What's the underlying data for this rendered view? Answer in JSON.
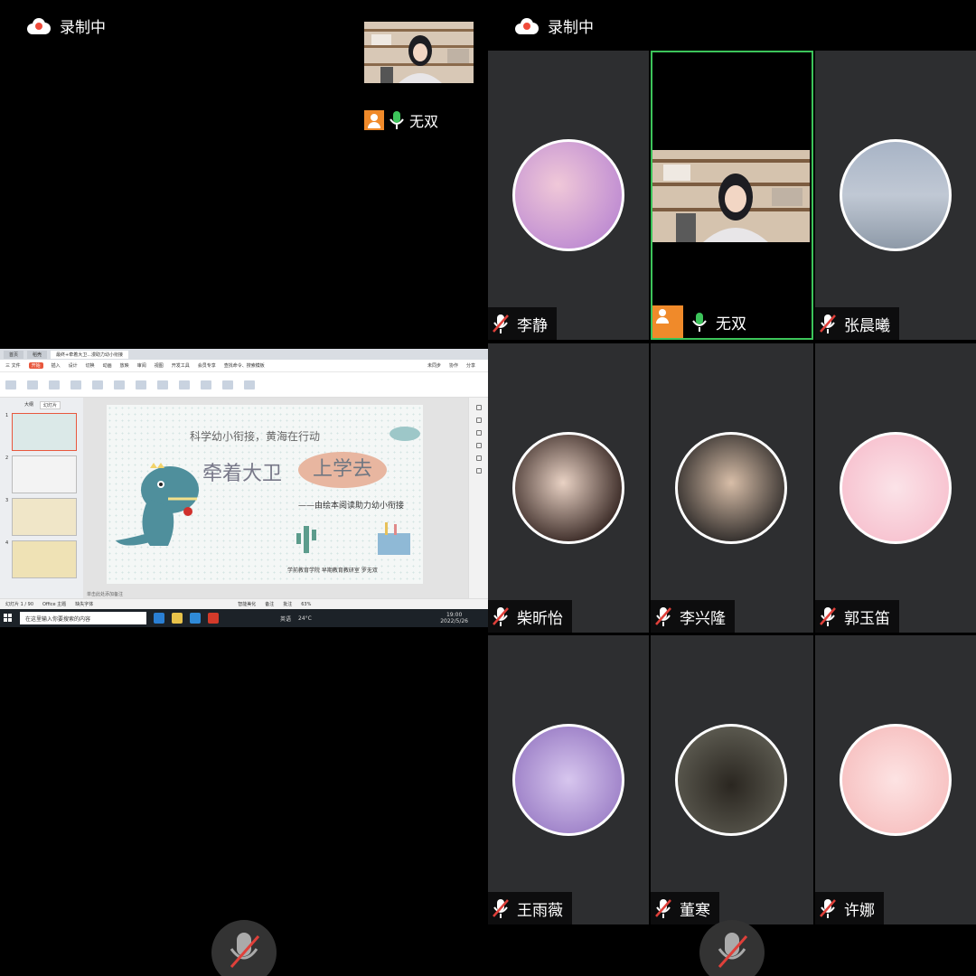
{
  "recording_label": "录制中",
  "self_view": {
    "name": "无双"
  },
  "shared_screen": {
    "browser_tabs": [
      "首页",
      "稻壳",
      "最终+牵着大卫...漫助力幼小衔接"
    ],
    "menu": [
      "三 文件",
      "开始",
      "插入",
      "设计",
      "切换",
      "动画",
      "放映",
      "审阅",
      "视图",
      "开发工具",
      "会员专享",
      "查找命令、搜索模板",
      "未同步",
      "协作",
      "分享"
    ],
    "panel_tabs": [
      "大纲",
      "幻灯片"
    ],
    "slide_numbers": [
      "1",
      "2",
      "3",
      "4"
    ],
    "slide": {
      "top_line": "科学幼小衔接，黄海在行动",
      "title_a": "牵着大卫",
      "title_b": "上学去",
      "subtitle": "——由绘本阅读助力幼小衔接",
      "credit": "学前教育学院    早期教育教研室  罗无双"
    },
    "notes_placeholder": "单击此处添加备注",
    "status": {
      "slide_count": "幻灯片 1 / 90",
      "theme": "Office 主题",
      "font_missing": "缺失字体",
      "smart_beautify": "智能美化",
      "notes": "备注",
      "comment": "批注",
      "zoom": "63%"
    },
    "taskbar": {
      "search_placeholder": "在这里输入你要搜索的内容",
      "temp": "24°C",
      "time": "19:00",
      "date": "2022/5/26",
      "lang": "英语"
    }
  },
  "participants": [
    {
      "name": "李静",
      "muted": true
    },
    {
      "name": "无双",
      "muted": false,
      "speaking": true
    },
    {
      "name": "张晨曦",
      "muted": true
    },
    {
      "name": "柴昕怡",
      "muted": true
    },
    {
      "name": "李兴隆",
      "muted": true
    },
    {
      "name": "郭玉笛",
      "muted": true
    },
    {
      "name": "王雨薇",
      "muted": true
    },
    {
      "name": "董寒",
      "muted": true
    },
    {
      "name": "许娜",
      "muted": true
    }
  ],
  "colors": {
    "accent_green": "#3cc45a",
    "muted_red": "#e0403a",
    "avatar_orange": "#f08a2a",
    "tile_bg": "#2d2e30"
  }
}
